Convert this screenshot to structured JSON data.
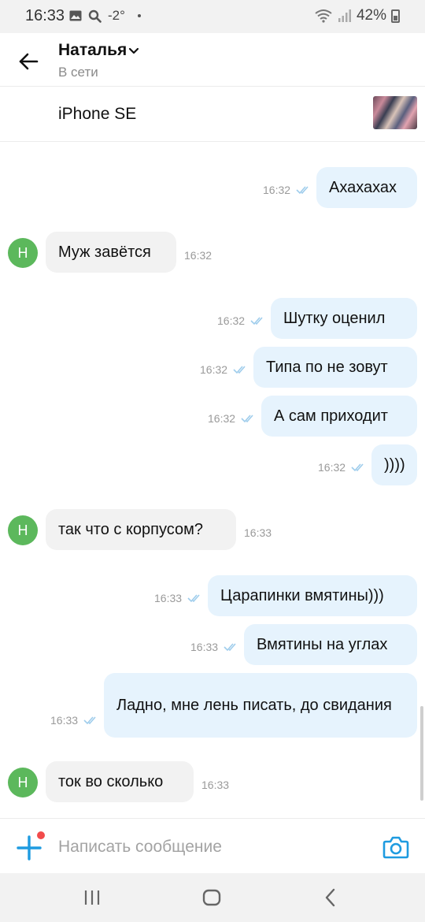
{
  "status_bar": {
    "time": "16:33",
    "temperature": "-2°",
    "battery": "42%",
    "icons": [
      "image-icon",
      "search-icon",
      "wifi-icon",
      "signal-icon",
      "battery-icon"
    ]
  },
  "header": {
    "contact_name": "Наталья",
    "status": "В сети"
  },
  "item": {
    "title": "iPhone SE"
  },
  "messages": [
    {
      "direction": "out",
      "text": "Ахахахах",
      "time": "16:32"
    },
    {
      "direction": "in",
      "text": "Муж завётся",
      "time": "16:32",
      "avatar": "Н"
    },
    {
      "direction": "out",
      "text": "Шутку оценил",
      "time": "16:32"
    },
    {
      "direction": "out",
      "text": "Типа по не зовут",
      "time": "16:32"
    },
    {
      "direction": "out",
      "text": "А сам приходит",
      "time": "16:32"
    },
    {
      "direction": "out",
      "text": "))))",
      "time": "16:32"
    },
    {
      "direction": "in",
      "text": "так что с корпусом?",
      "time": "16:33",
      "avatar": "Н"
    },
    {
      "direction": "out",
      "text": "Царапинки вмятины)))",
      "time": "16:33"
    },
    {
      "direction": "out",
      "text": "Вмятины на углах",
      "time": "16:33"
    },
    {
      "direction": "out",
      "text": "Ладно, мне лень писать, до свидания",
      "time": "16:33"
    },
    {
      "direction": "in",
      "text": "ток во сколько",
      "time": "16:33",
      "avatar": "Н"
    }
  ],
  "composer": {
    "placeholder": "Написать сообщение"
  },
  "colors": {
    "accent": "#1e9be0",
    "outgoing_bubble": "#e6f3fd",
    "incoming_bubble": "#f2f2f2",
    "avatar": "#5cb85c",
    "notification_dot": "#f24b4b"
  }
}
